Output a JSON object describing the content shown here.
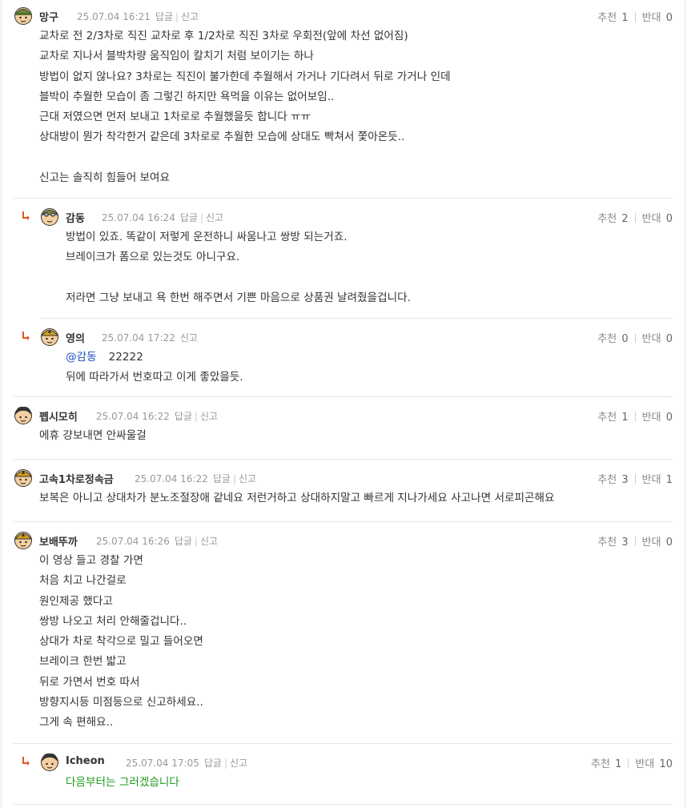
{
  "comments": [
    {
      "nick": "망구",
      "date": "25.07.04 16:21",
      "reply": "답글",
      "report": "신고",
      "rec_label": "추천",
      "rec": "1",
      "opp_label": "반대",
      "opp": "0",
      "lines": [
        "교차로 전 2/3차로 직진 교차로 후 1/2차로 직진 3차로 우회전(앞에 차선 없어짐)",
        "교차로 지나서 블박차량 움직임이 칼치기 처럼 보이기는 하나",
        "방법이 없지 않나요? 3차로는 직진이 불가한데 추월해서 가거나 기다려서 뒤로 가거나 인데",
        "블박이 추월한 모습이 좀 그렇긴 하지만 욕먹을 이유는 없어보임..",
        "근대 저였으면 먼저 보내고 1차로로 추월했을듯 합니다 ㅠㅠ",
        "상대방이 뭔가 착각한거 같은데 3차로로 추월한 모습에 상대도 빡쳐서 쫓아온듯..",
        "",
        "신고는 솔직히 힘들어 보여요"
      ]
    },
    {
      "nick": "감동",
      "date": "25.07.04 16:24",
      "reply": "답글",
      "report": "신고",
      "rec_label": "추천",
      "rec": "2",
      "opp_label": "반대",
      "opp": "0",
      "lines": [
        "방법이 있죠. 똑같이 저렇게 운전하니 싸움나고 쌍방 되는거죠.",
        "브레이크가 폼으로 있는것도 아니구요.",
        "",
        "저라면 그냥 보내고 욕 한번 해주면서 기쁜 마음으로 상품권 날려줬을겁니다."
      ]
    },
    {
      "nick": "영의",
      "date": "25.07.04 17:22",
      "report": "신고",
      "rec_label": "추천",
      "rec": "0",
      "opp_label": "반대",
      "opp": "0",
      "mention": "@감동",
      "mention_text": "22222",
      "lines": [
        "뒤에 따라가서 번호따고 이게 좋았을듯."
      ]
    },
    {
      "nick": "펩시모히",
      "date": "25.07.04 16:22",
      "reply": "답글",
      "report": "신고",
      "rec_label": "추천",
      "rec": "1",
      "opp_label": "반대",
      "opp": "0",
      "lines": [
        "에휴 걍보내면 안싸울걸"
      ]
    },
    {
      "nick": "고속1차로정속금",
      "date": "25.07.04 16:22",
      "reply": "답글",
      "report": "신고",
      "rec_label": "추천",
      "rec": "3",
      "opp_label": "반대",
      "opp": "1",
      "lines": [
        "보복은 아니고 상대차가 분노조절장애 같네요 저런거하고 상대하지말고 빠르게 지나가세요 사고나면 서로피곤해요"
      ]
    },
    {
      "nick": "보배뚜까",
      "date": "25.07.04 16:26",
      "reply": "답글",
      "report": "신고",
      "rec_label": "추천",
      "rec": "3",
      "opp_label": "반대",
      "opp": "0",
      "lines": [
        "이 영상 들고 경찰 가면",
        "처음 치고 나간걸로",
        "원인제공 했다고",
        "쌍방 나오고 처리 안해줄겁니다..",
        "상대가 차로 착각으로 밀고 들어오면",
        "브레이크 한번 밟고",
        "뒤로 가면서 번호 따서",
        "방향지시등 미점등으로 신고하세요..",
        "그게 속 편해요.."
      ]
    },
    {
      "nick": "Icheon",
      "date": "25.07.04 17:05",
      "reply": "답글",
      "report": "신고",
      "rec_label": "추천",
      "rec": "1",
      "opp_label": "반대",
      "opp": "10",
      "lines": [
        "다음부터는 그러겠습니다"
      ]
    }
  ],
  "icons": {
    "reply_arrow": "reply-arrow-icon",
    "avatar": "user-avatar-icon"
  },
  "colors": {
    "mention": "#1a4fc4",
    "reply_text": "#1e9a1e",
    "reply_arrow": "#e8541e"
  }
}
